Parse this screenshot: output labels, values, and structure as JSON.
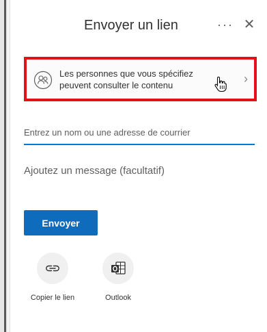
{
  "header": {
    "title": "Envoyer un lien",
    "more_label": "···",
    "close_label": "✕"
  },
  "permission": {
    "line1": "Les personnes que vous spécifiez",
    "line2": "peuvent consulter le contenu",
    "chevron": "›"
  },
  "recipient": {
    "placeholder": "Entrez un nom ou une adresse de courrier",
    "value": ""
  },
  "message": {
    "placeholder": "Ajoutez un message (facultatif)",
    "value": ""
  },
  "send_button": {
    "label": "Envoyer"
  },
  "share_options": [
    {
      "label": "Copier le lien",
      "icon": "link-icon"
    },
    {
      "label": "Outlook",
      "icon": "outlook-icon"
    }
  ],
  "colors": {
    "accent": "#0f6cbd",
    "focus_underline": "#0078d4",
    "highlight_border": "#e3101c"
  }
}
